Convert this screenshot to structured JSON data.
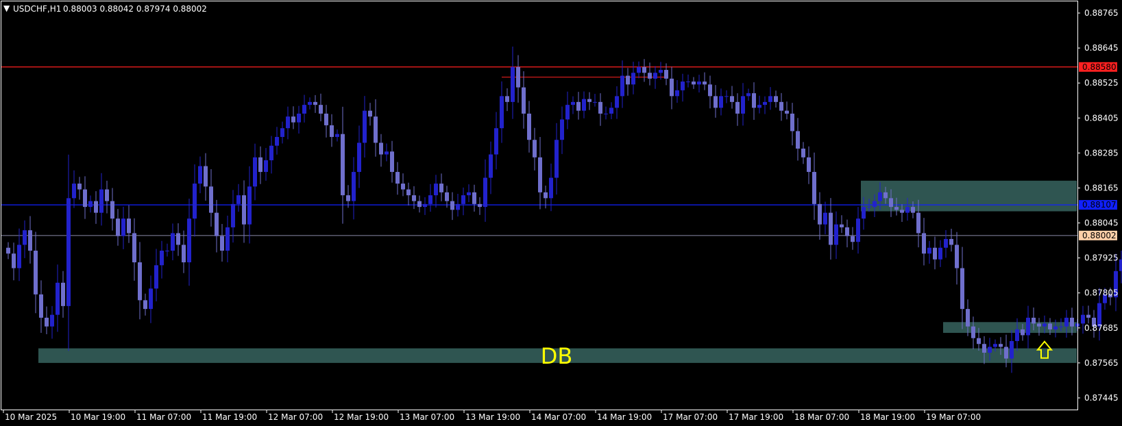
{
  "header": {
    "symbol_label": "USDCHF,H1",
    "ohlc_label": "0.88003 0.88042 0.87974 0.88002",
    "menu_glyph": "▼"
  },
  "colors": {
    "background": "#000000",
    "frame": "#ffffff",
    "bull_candle": "#2222cc",
    "bear_candle": "#6f6fcc",
    "resistance_line": "#ff2020",
    "support_line": "#1020ff",
    "price_line": "#8a8aa8",
    "zone_fill": "#2f5551",
    "annotation": "#ffff00",
    "price_badge": "#ffd0a8"
  },
  "chart_data": {
    "type": "candlestick",
    "symbol": "USDCHF",
    "timeframe": "H1",
    "y_ticks": [
      "0.88765",
      "0.88645",
      "0.88525",
      "0.88405",
      "0.88285",
      "0.88165",
      "0.88045",
      "0.87925",
      "0.87805",
      "0.87685",
      "0.87565",
      "0.87445"
    ],
    "ylim": [
      0.87405,
      0.88805
    ],
    "x_ticks": [
      "10 Mar 2025",
      "10 Mar 19:00",
      "11 Mar 07:00",
      "11 Mar 19:00",
      "12 Mar 07:00",
      "12 Mar 19:00",
      "13 Mar 07:00",
      "13 Mar 19:00",
      "14 Mar 07:00",
      "14 Mar 19:00",
      "17 Mar 07:00",
      "17 Mar 19:00",
      "18 Mar 07:00",
      "18 Mar 19:00",
      "19 Mar 07:00"
    ],
    "bar_count": 218,
    "bars_per_x_tick": 12,
    "horizontal_lines": [
      {
        "name": "resistance",
        "price": 0.8858,
        "label": "0.88580",
        "color": "#ff2020"
      },
      {
        "name": "support",
        "price": 0.88107,
        "label": "0.88107",
        "color": "#1020ff"
      },
      {
        "name": "current-price",
        "price": 0.88002,
        "label": "0.88002",
        "color": "#8a8aa8"
      }
    ],
    "short_line": {
      "price": 0.88545,
      "from_bar": 90,
      "to_bar": 120
    },
    "zones": [
      {
        "name": "upper-zone",
        "from_bar": 156,
        "to_bar": 218,
        "top": 0.8819,
        "bottom": 0.88085
      },
      {
        "name": "db-zone",
        "from_bar": 6,
        "to_bar": 196,
        "top": 0.87615,
        "bottom": 0.87565
      },
      {
        "name": "low-zone",
        "from_bar": 171,
        "to_bar": 197,
        "top": 0.87705,
        "bottom": 0.87668
      }
    ],
    "annotation_text": "DB",
    "annotation_bar": 100,
    "annotation_price": 0.8759,
    "arrow_bar": 189,
    "arrow_price": 0.8761,
    "closes": [
      0.8794,
      0.8789,
      0.8797,
      0.8802,
      0.8795,
      0.878,
      0.8772,
      0.8769,
      0.8773,
      0.8784,
      0.8776,
      0.8813,
      0.8818,
      0.8816,
      0.881,
      0.8812,
      0.8808,
      0.8816,
      0.8812,
      0.8806,
      0.88,
      0.8806,
      0.8801,
      0.8791,
      0.8778,
      0.8775,
      0.8782,
      0.879,
      0.8795,
      0.8795,
      0.8801,
      0.8797,
      0.8791,
      0.8806,
      0.8818,
      0.8824,
      0.8817,
      0.8808,
      0.88,
      0.8795,
      0.8803,
      0.8811,
      0.8814,
      0.8804,
      0.8817,
      0.8827,
      0.8822,
      0.8826,
      0.8831,
      0.8834,
      0.8837,
      0.8841,
      0.8839,
      0.8842,
      0.8845,
      0.8846,
      0.8845,
      0.8842,
      0.8838,
      0.8834,
      0.8835,
      0.8814,
      0.8812,
      0.8822,
      0.8832,
      0.8843,
      0.8841,
      0.8832,
      0.8828,
      0.8829,
      0.8822,
      0.8818,
      0.8816,
      0.8814,
      0.8812,
      0.881,
      0.8811,
      0.8814,
      0.8818,
      0.8815,
      0.8812,
      0.8809,
      0.8811,
      0.8814,
      0.8815,
      0.8811,
      0.881,
      0.882,
      0.8828,
      0.8837,
      0.8848,
      0.8846,
      0.8858,
      0.8851,
      0.8842,
      0.8833,
      0.8827,
      0.8815,
      0.8813,
      0.882,
      0.8833,
      0.884,
      0.8845,
      0.8846,
      0.8843,
      0.8847,
      0.8846,
      0.8846,
      0.8842,
      0.8842,
      0.8844,
      0.8848,
      0.8855,
      0.8852,
      0.8856,
      0.8858,
      0.8856,
      0.8854,
      0.8856,
      0.8857,
      0.8854,
      0.8848,
      0.885,
      0.8853,
      0.8853,
      0.8852,
      0.8853,
      0.8852,
      0.8848,
      0.8844,
      0.8848,
      0.8848,
      0.8846,
      0.8842,
      0.8848,
      0.8849,
      0.8844,
      0.8845,
      0.8846,
      0.8848,
      0.8846,
      0.8843,
      0.8842,
      0.8836,
      0.883,
      0.8827,
      0.8822,
      0.8811,
      0.8804,
      0.8808,
      0.8797,
      0.8804,
      0.8803,
      0.88,
      0.8798,
      0.8806,
      0.881,
      0.881,
      0.8812,
      0.8815,
      0.8813,
      0.881,
      0.8809,
      0.8808,
      0.881,
      0.8808,
      0.8801,
      0.8794,
      0.8796,
      0.8792,
      0.8796,
      0.8799,
      0.8797,
      0.8789,
      0.8775,
      0.8769,
      0.8765,
      0.8763,
      0.876,
      0.8762,
      0.8763,
      0.8762,
      0.8758,
      0.8764,
      0.8768,
      0.8766,
      0.8772,
      0.877,
      0.8769,
      0.877,
      0.8768,
      0.8769,
      0.8769,
      0.8772,
      0.8769,
      0.877,
      0.8773,
      0.8772,
      0.8769,
      0.8777,
      0.878,
      0.8779,
      0.8788,
      0.8792,
      0.8796,
      0.88
    ]
  }
}
